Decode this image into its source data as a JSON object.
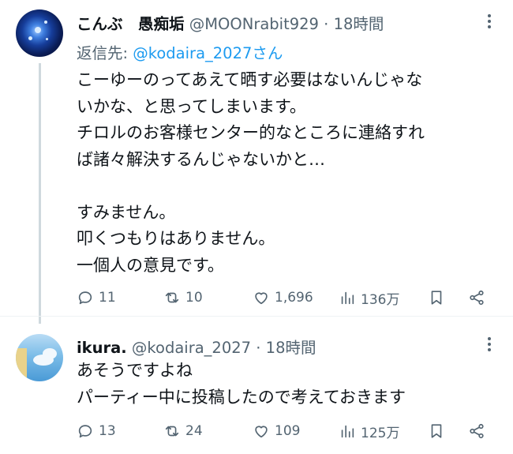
{
  "tweets": [
    {
      "name": "こんぶ　愚痴垢",
      "handle": "@MOONrabit929",
      "dot": "·",
      "time": "18時間",
      "reply_to_label": "返信先: ",
      "reply_to_handle": "@kodaira_2027さん",
      "lines": [
        "こーゆーのってあえて晒す必要はないんじゃな",
        "いかな、と思ってしまいます。",
        "チロルのお客様センター的なところに連絡すれ",
        "ば諸々解決するんじゃないかと…",
        "",
        "すみません。",
        "叩くつもりはありません。",
        "一個人の意見です。"
      ],
      "actions": {
        "replies": "11",
        "retweets": "10",
        "likes": "1,696",
        "views": "136万"
      }
    },
    {
      "name": "ikura.",
      "handle": "@kodaira_2027",
      "dot": "·",
      "time": "18時間",
      "lines": [
        "あそうですよね",
        "パーティー中に投稿したので考えておきます"
      ],
      "actions": {
        "replies": "13",
        "retweets": "24",
        "likes": "109",
        "views": "125万"
      }
    }
  ],
  "icons": {
    "reply": "reply-icon",
    "retweet": "retweet-icon",
    "like": "heart-icon",
    "views": "views-icon",
    "bookmark": "bookmark-icon",
    "share": "share-icon",
    "more": "more-icon"
  },
  "colors": {
    "text": "#0f1419",
    "secondary": "#536471",
    "link": "#1d9bf0"
  }
}
